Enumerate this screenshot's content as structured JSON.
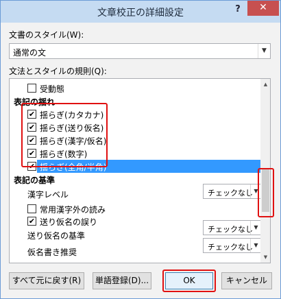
{
  "window": {
    "title": "文章校正の詳細設定",
    "help_label": "?",
    "close_label": "✕"
  },
  "style": {
    "label": "文書のスタイル(W):",
    "value": "通常の文"
  },
  "rules": {
    "label": "文法とスタイルの規則(Q):",
    "items": [
      {
        "kind": "checkbox",
        "label": "受動態",
        "checked": false
      },
      {
        "kind": "heading",
        "label": "表記の揺れ"
      },
      {
        "kind": "checkbox",
        "label": "揺らぎ(カタカナ)",
        "checked": true
      },
      {
        "kind": "checkbox",
        "label": "揺らぎ(送り仮名)",
        "checked": true
      },
      {
        "kind": "checkbox",
        "label": "揺らぎ(漢字/仮名)",
        "checked": true
      },
      {
        "kind": "checkbox",
        "label": "揺らぎ(数字)",
        "checked": true
      },
      {
        "kind": "checkbox",
        "label": "揺らぎ(全角/半角)",
        "checked": true,
        "selected": true
      },
      {
        "kind": "heading",
        "label": "表記の基準"
      },
      {
        "kind": "select",
        "label": "漢字レベル",
        "value": "チェックなし"
      },
      {
        "kind": "checkbox",
        "label": "常用漢字外の読み",
        "checked": false
      },
      {
        "kind": "checkbox",
        "label": "送り仮名の誤り",
        "checked": true
      },
      {
        "kind": "select",
        "label": "送り仮名の基準",
        "value": "チェックなし"
      },
      {
        "kind": "select",
        "label": "仮名書き推奨",
        "value": "チェックなし"
      }
    ]
  },
  "check_mark": "✔",
  "scroll": {
    "up": "▲",
    "down": "▼"
  },
  "dropdown_arrow": "▼",
  "buttons": {
    "reset": "すべて元に戻す(R)",
    "dictionary": "単語登録(D)...",
    "ok": "OK",
    "cancel": "キャンセル"
  },
  "colors": {
    "selection": "#3399ff",
    "highlight_box": "#e01010",
    "close_button": "#c75050"
  }
}
